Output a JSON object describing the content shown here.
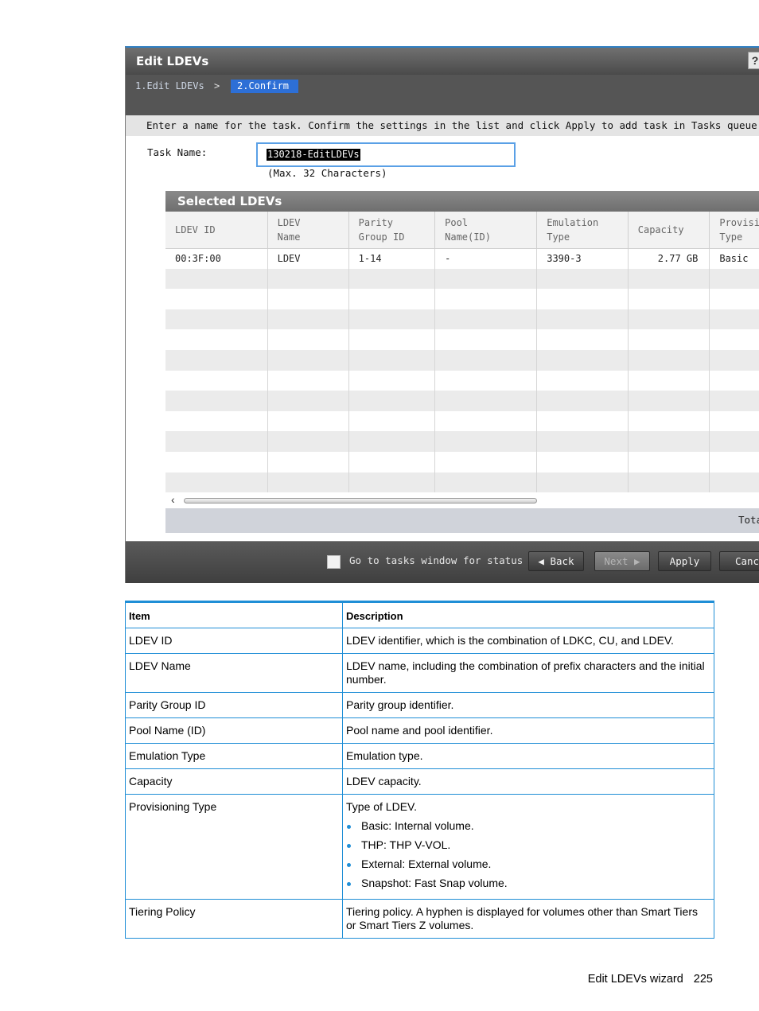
{
  "window": {
    "title": "Edit LDEVs",
    "help_icon": "?",
    "breadcrumb": {
      "step1": "1.Edit LDEVs",
      "separator": ">",
      "step2": "2.Confirm"
    },
    "instruction": "Enter a name for the task. Confirm the settings in the list and click Apply to add task in Tasks queue for ex",
    "task_name_label": "Task Name:",
    "task_name_value": "130218-EditLDEVs",
    "task_name_hint": "(Max. 32 Characters)",
    "panel_title": "Selected LDEVs",
    "columns": [
      [
        "LDEV ID",
        ""
      ],
      [
        "LDEV",
        "Name"
      ],
      [
        "Parity",
        "Group ID"
      ],
      [
        "Pool",
        "Name(ID)"
      ],
      [
        "Emulation",
        "Type"
      ],
      [
        "Capacity",
        ""
      ],
      [
        "Provisi",
        "Type"
      ]
    ],
    "rows": [
      [
        "00:3F:00",
        "LDEV",
        "1-14",
        "-",
        "3390-3",
        "2.77 GB",
        "Basic"
      ]
    ],
    "scroll_left_icon": "‹",
    "total_label": "Tota",
    "go_to_tasks_label": "Go to tasks window for status",
    "buttons": {
      "back": "Back",
      "next": "Next",
      "apply": "Apply",
      "cancel": "Canc"
    },
    "colors": {
      "accent": "#2d6fd6",
      "titlebar": "#555555"
    }
  },
  "description_table": {
    "headers": {
      "item": "Item",
      "description": "Description"
    },
    "rows": {
      "ldev_id": {
        "item": "LDEV ID",
        "description": "LDEV identifier, which is the combination of LDKC, CU, and LDEV."
      },
      "ldev_name": {
        "item": "LDEV Name",
        "description": "LDEV name, including the combination of prefix characters and the initial number."
      },
      "parity_group": {
        "item": "Parity Group ID",
        "description": "Parity group identifier."
      },
      "pool_name": {
        "item": "Pool Name (ID)",
        "description": "Pool name and pool identifier."
      },
      "emulation": {
        "item": "Emulation Type",
        "description": "Emulation type."
      },
      "capacity": {
        "item": "Capacity",
        "description": "LDEV capacity."
      },
      "provisioning": {
        "item": "Provisioning Type",
        "description": "Type of LDEV.",
        "bullets": [
          "Basic: Internal volume.",
          "THP: THP V-VOL.",
          "External: External volume.",
          "Snapshot: Fast Snap volume."
        ]
      },
      "tiering": {
        "item": "Tiering Policy",
        "description": "Tiering policy. A hyphen is displayed for volumes other than Smart Tiers or Smart Tiers Z volumes."
      }
    },
    "accent_color": "#1f8ed6"
  },
  "footer": {
    "section": "Edit LDEVs wizard",
    "page": "225"
  }
}
